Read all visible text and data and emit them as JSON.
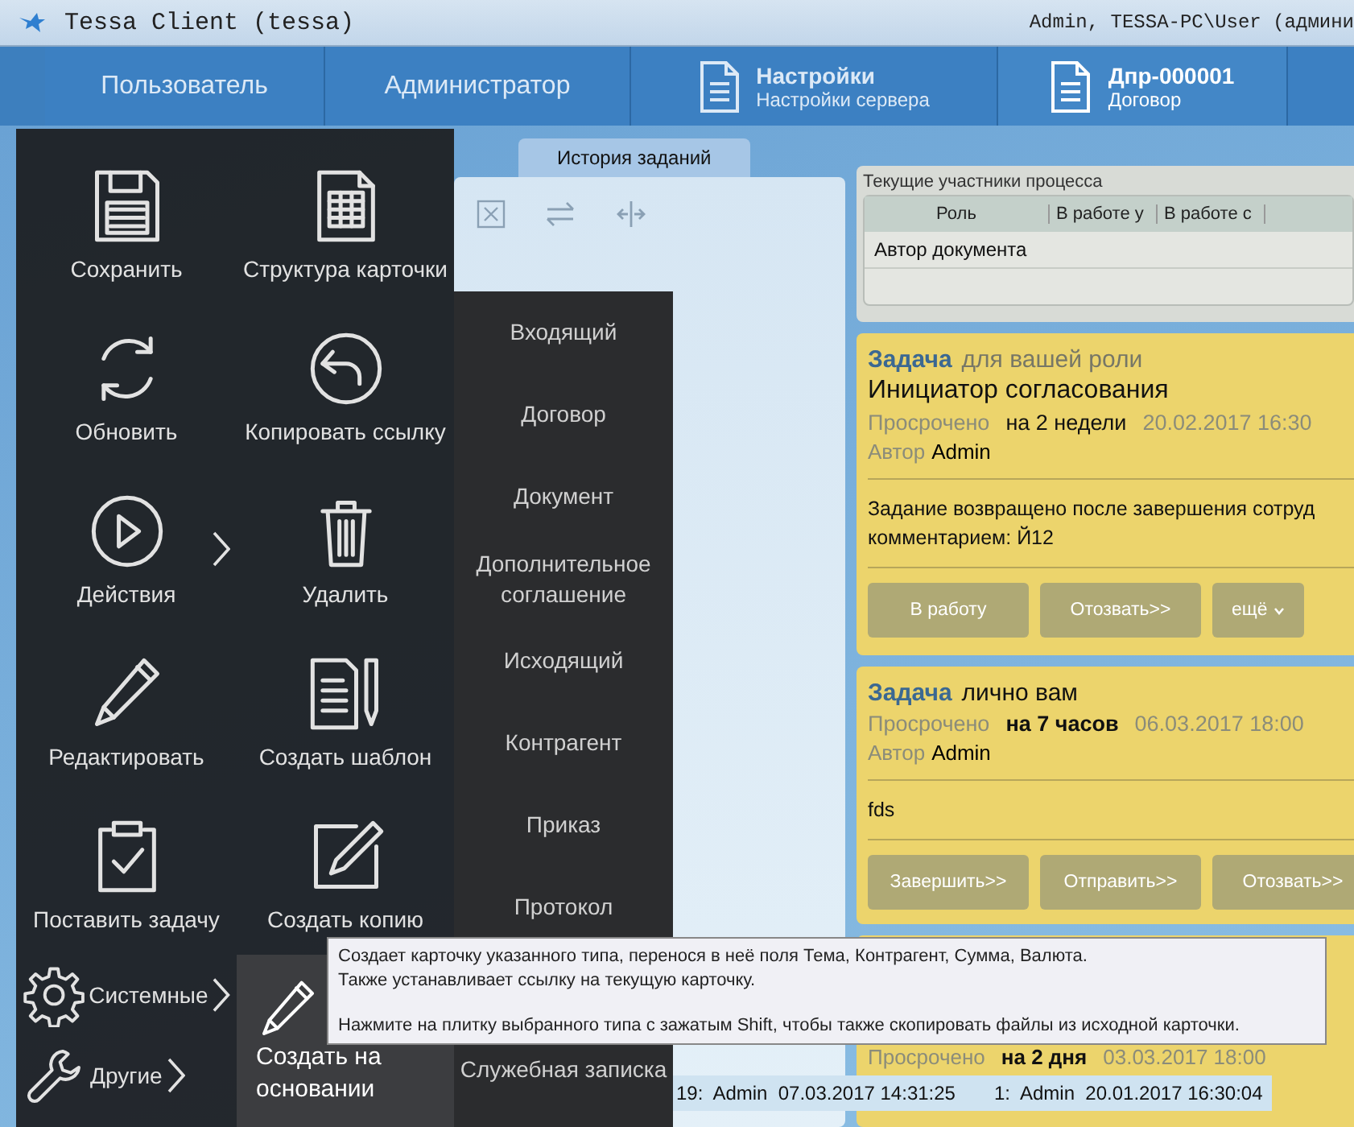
{
  "window": {
    "title": "Tessa Client (tessa)",
    "user": "Admin, TESSA-PC\\User (админи"
  },
  "tabs": [
    {
      "title": "Пользователь",
      "selected": false
    },
    {
      "title": "Администратор",
      "selected": false
    },
    {
      "title": "Настройки",
      "subtitle": "Настройки сервера",
      "selected": false
    },
    {
      "title": "Дпр-000001",
      "subtitle": "Договор",
      "selected": true
    }
  ],
  "card_tabs": [
    {
      "label": "История заданий",
      "selected": false
    }
  ],
  "participants": {
    "title": "Текущие участники процесса",
    "columns": [
      "Роль",
      "В работе у",
      "В работе с"
    ],
    "rows": [
      {
        "role": "Автор документа"
      }
    ]
  },
  "tasks": [
    {
      "kind_label": "Задача",
      "scope": "для вашей роли",
      "personal": false,
      "name": "Инициатор согласования",
      "overdue_label": "Просрочено",
      "overdue": "на 2 недели",
      "urgent": false,
      "date": "20.02.2017 16:30",
      "author_label": "Автор",
      "author": "Admin",
      "comment_lines": [
        "Задание возвращено после завершения сотруд",
        "комментарием: Й12"
      ],
      "buttons": [
        {
          "label": "В работу",
          "caret": false
        },
        {
          "label": "Отозвать>>",
          "caret": false
        },
        {
          "label": "ещё",
          "caret": true
        }
      ]
    },
    {
      "kind_label": "Задача",
      "scope": "лично вам",
      "personal": true,
      "overdue_label": "Просрочено",
      "overdue": "на 7 часов",
      "urgent": true,
      "date": "06.03.2017 18:00",
      "author_label": "Автор",
      "author": "Admin",
      "comment_lines": [
        "fds"
      ],
      "buttons": [
        {
          "label": "Завершить>>",
          "caret": false
        },
        {
          "label": "Отправить>>",
          "caret": false
        },
        {
          "label": "Отозвать>>",
          "caret": false
        }
      ]
    },
    {
      "overdue_label": "Просрочено",
      "overdue": "на 2 дня",
      "urgent": true,
      "date": "03.03.2017 18:00"
    }
  ],
  "menu": {
    "tiles": [
      {
        "label": "Сохранить",
        "kind": "save",
        "submenu": false
      },
      {
        "label": "Структура карточки",
        "kind": "table",
        "submenu": false
      },
      {
        "label": "Обновить",
        "kind": "refresh",
        "submenu": false
      },
      {
        "label": "Копировать ссылку",
        "kind": "back",
        "submenu": false
      },
      {
        "label": "Действия",
        "kind": "play",
        "submenu": true
      },
      {
        "label": "Удалить",
        "kind": "trash",
        "submenu": false
      },
      {
        "label": "Редактировать",
        "kind": "pencil",
        "submenu": false
      },
      {
        "label": "Создать шаблон",
        "kind": "template",
        "submenu": false
      },
      {
        "label": "Поставить задачу",
        "kind": "clipboard",
        "submenu": false
      },
      {
        "label": "Создать копию",
        "kind": "edit",
        "submenu": false
      }
    ],
    "small_items": [
      {
        "label": "Системные",
        "kind": "gear",
        "submenu": true
      },
      {
        "label": "Другие",
        "kind": "wrench",
        "submenu": true
      }
    ],
    "active_tile": {
      "label": "Создать на основании",
      "kind": "pencil",
      "selected": true
    },
    "types": [
      "Входящий",
      "Договор",
      "Документ",
      "Дополнительное соглашение",
      "Исходящий",
      "Контрагент",
      "Приказ",
      "Протокол",
      "Служебная записка"
    ]
  },
  "tooltip": {
    "lines": [
      "Создает карточку указанного типа, перенося в неё поля Тема, Контрагент, Сумма, Валюта.",
      "Также устанавливает ссылку на текущую карточку.",
      "Нажмите на плитку выбранного типа с зажатым Shift, чтобы также скопировать файлы из исходной карточки."
    ]
  },
  "status_bar": {
    "items": [
      "19:  Admin  07.03.2017 14:31:25",
      "1:  Admin  20.01.2017 16:30:04"
    ]
  }
}
